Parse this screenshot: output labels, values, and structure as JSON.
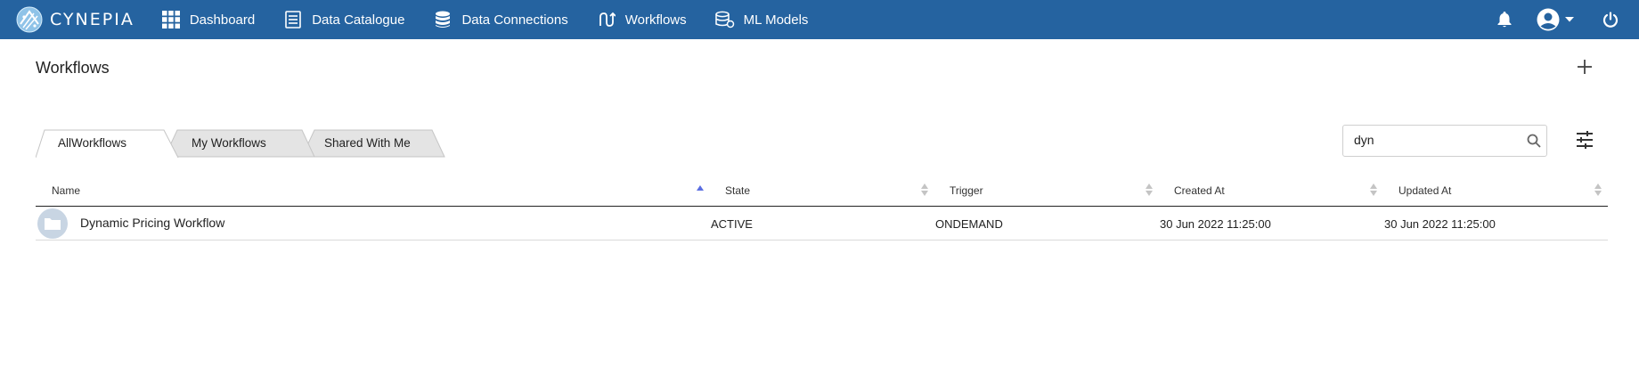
{
  "app": {
    "brand": "CYNEPIA",
    "nav": [
      {
        "label": "Dashboard",
        "icon": "grid-icon"
      },
      {
        "label": "Data Catalogue",
        "icon": "catalogue-icon"
      },
      {
        "label": "Data Connections",
        "icon": "database-icon"
      },
      {
        "label": "Workflows",
        "icon": "workflow-icon"
      },
      {
        "label": "ML Models",
        "icon": "ml-models-icon"
      }
    ],
    "header_icons": [
      "bell-icon",
      "account-icon",
      "chevron-down-icon",
      "power-icon"
    ]
  },
  "page": {
    "title": "Workflows",
    "tabs": [
      {
        "label": "AllWorkflows",
        "active": true
      },
      {
        "label": "My Workflows",
        "active": false
      },
      {
        "label": "Shared With Me",
        "active": false
      }
    ],
    "search": {
      "value": "dyn",
      "placeholder": ""
    }
  },
  "table": {
    "columns": [
      "Name",
      "State",
      "Trigger",
      "Created At",
      "Updated At"
    ],
    "sorted_column": "Name",
    "rows": [
      {
        "name": "Dynamic Pricing Workflow",
        "state": "ACTIVE",
        "trigger": "ONDEMAND",
        "created_at": "30 Jun 2022 11:25:00",
        "updated_at": "30 Jun 2022 11:25:00"
      }
    ]
  },
  "colors": {
    "topbar": "#2563a0",
    "active_tab": "#ffffff",
    "inactive_tab": "#e4e4e4",
    "sort_active": "#5b6ee1"
  }
}
